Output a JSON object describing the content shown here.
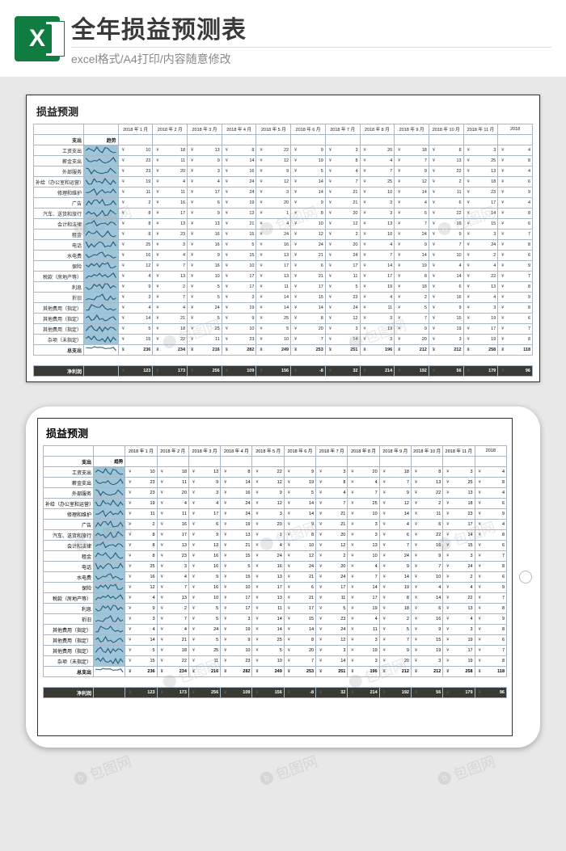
{
  "banner": {
    "icon_letter": "X",
    "title": "全年损益预测表",
    "subtitle": "excel格式/A4打印/内容随意修改"
  },
  "sheet": {
    "title": "损益预测",
    "section_label": "支出",
    "trend_label": "趋势",
    "months": [
      "2018 年 1 月",
      "2018 年 2 月",
      "2018 年 3 月",
      "2018 年 4 月",
      "2018 年 5 月",
      "2018 年 6 月",
      "2018 年 7 月",
      "2018 年 8 月",
      "2018 年 9 月",
      "2018 年 10 月",
      "2018 年 11 月",
      "2018"
    ],
    "currency": "¥",
    "rows": [
      {
        "label": "工资支出",
        "values": [
          10,
          18,
          13,
          8,
          22,
          9,
          3,
          20,
          18,
          8,
          3,
          4
        ]
      },
      {
        "label": "薪金支出",
        "values": [
          23,
          11,
          9,
          14,
          12,
          19,
          8,
          4,
          7,
          13,
          25,
          8
        ]
      },
      {
        "label": "外部服务",
        "values": [
          23,
          20,
          3,
          16,
          9,
          5,
          4,
          7,
          9,
          22,
          13,
          4
        ]
      },
      {
        "label": "补给（办公室和运营）",
        "values": [
          19,
          4,
          4,
          24,
          12,
          14,
          7,
          25,
          12,
          2,
          18,
          6
        ]
      },
      {
        "label": "修理和维护",
        "values": [
          11,
          11,
          17,
          24,
          3,
          14,
          21,
          10,
          14,
          11,
          23,
          9
        ]
      },
      {
        "label": "广告",
        "values": [
          2,
          16,
          6,
          19,
          20,
          9,
          21,
          3,
          4,
          6,
          17,
          4
        ]
      },
      {
        "label": "汽车、送货和旅行",
        "values": [
          8,
          17,
          9,
          13,
          1,
          8,
          20,
          3,
          6,
          22,
          14,
          8
        ]
      },
      {
        "label": "会计和法律",
        "values": [
          8,
          13,
          13,
          21,
          4,
          10,
          12,
          13,
          7,
          16,
          15,
          6
        ]
      },
      {
        "label": "租金",
        "values": [
          8,
          23,
          16,
          15,
          24,
          12,
          2,
          10,
          24,
          9,
          3,
          7
        ]
      },
      {
        "label": "电话",
        "values": [
          25,
          3,
          16,
          5,
          16,
          24,
          20,
          4,
          9,
          7,
          24,
          8
        ]
      },
      {
        "label": "水电费",
        "values": [
          16,
          4,
          9,
          15,
          13,
          21,
          24,
          7,
          14,
          10,
          2,
          6
        ]
      },
      {
        "label": "保险",
        "values": [
          12,
          7,
          16,
          10,
          17,
          6,
          17,
          14,
          19,
          4,
          4,
          9
        ]
      },
      {
        "label": "税款（房地产等）",
        "values": [
          4,
          13,
          10,
          17,
          13,
          21,
          11,
          17,
          8,
          14,
          22,
          7
        ]
      },
      {
        "label": "利息",
        "values": [
          9,
          2,
          5,
          17,
          11,
          17,
          5,
          19,
          18,
          6,
          13,
          8
        ]
      },
      {
        "label": "折旧",
        "values": [
          3,
          7,
          5,
          3,
          14,
          15,
          23,
          4,
          2,
          16,
          4,
          9
        ]
      },
      {
        "label": "其他费用（指定）",
        "values": [
          4,
          4,
          24,
          19,
          14,
          14,
          24,
          11,
          5,
          9,
          3,
          8
        ]
      },
      {
        "label": "其他费用（指定）",
        "values": [
          14,
          21,
          5,
          9,
          25,
          8,
          12,
          3,
          7,
          15,
          19,
          6
        ]
      },
      {
        "label": "其他费用（指定）",
        "values": [
          5,
          18,
          25,
          10,
          5,
          20,
          3,
          19,
          9,
          19,
          17,
          7
        ]
      },
      {
        "label": "杂项（未指定）",
        "values": [
          15,
          22,
          11,
          23,
          10,
          7,
          14,
          3,
          20,
          3,
          19,
          8
        ]
      }
    ],
    "total": {
      "label": "总支出",
      "values": [
        236,
        234,
        216,
        282,
        249,
        253,
        251,
        196,
        212,
        212,
        258,
        118
      ]
    },
    "net": {
      "label": "净利润",
      "values": [
        123,
        173,
        256,
        109,
        156,
        -8,
        32,
        214,
        192,
        56,
        179,
        96
      ]
    }
  },
  "watermark_text": "包图网"
}
